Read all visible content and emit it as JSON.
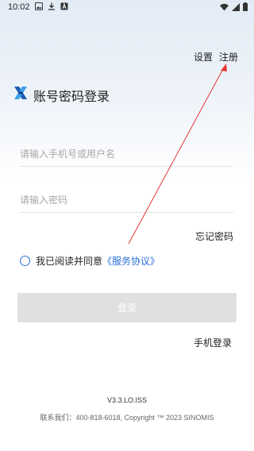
{
  "status_bar": {
    "time": "10:02",
    "left_icons": [
      "image-icon",
      "download-icon",
      "font-icon"
    ],
    "right_icons": [
      "wifi-icon",
      "signal-icon",
      "battery-icon"
    ]
  },
  "top_links": {
    "settings": "设置",
    "register": "注册"
  },
  "header": {
    "logo_icon": "app-logo-icon",
    "title": "账号密码登录"
  },
  "form": {
    "username_placeholder": "请输入手机号或用户名",
    "username_value": "",
    "password_placeholder": "请输入密码",
    "password_value": "",
    "forgot_password": "忘记密码",
    "agree_text": "我已阅读并同意",
    "agree_link": "《服务协议》",
    "agree_checked": false,
    "login_button": "登录",
    "phone_login": "手机登录"
  },
  "footer": {
    "version": "V3.3.LO.ISS",
    "contact": "联系我们：400-818-6018, Copyright ™ 2023 SINOMIS"
  },
  "colors": {
    "accent": "#2a72d8",
    "annotation": "#e53935",
    "button_disabled": "#e0e0e0"
  }
}
